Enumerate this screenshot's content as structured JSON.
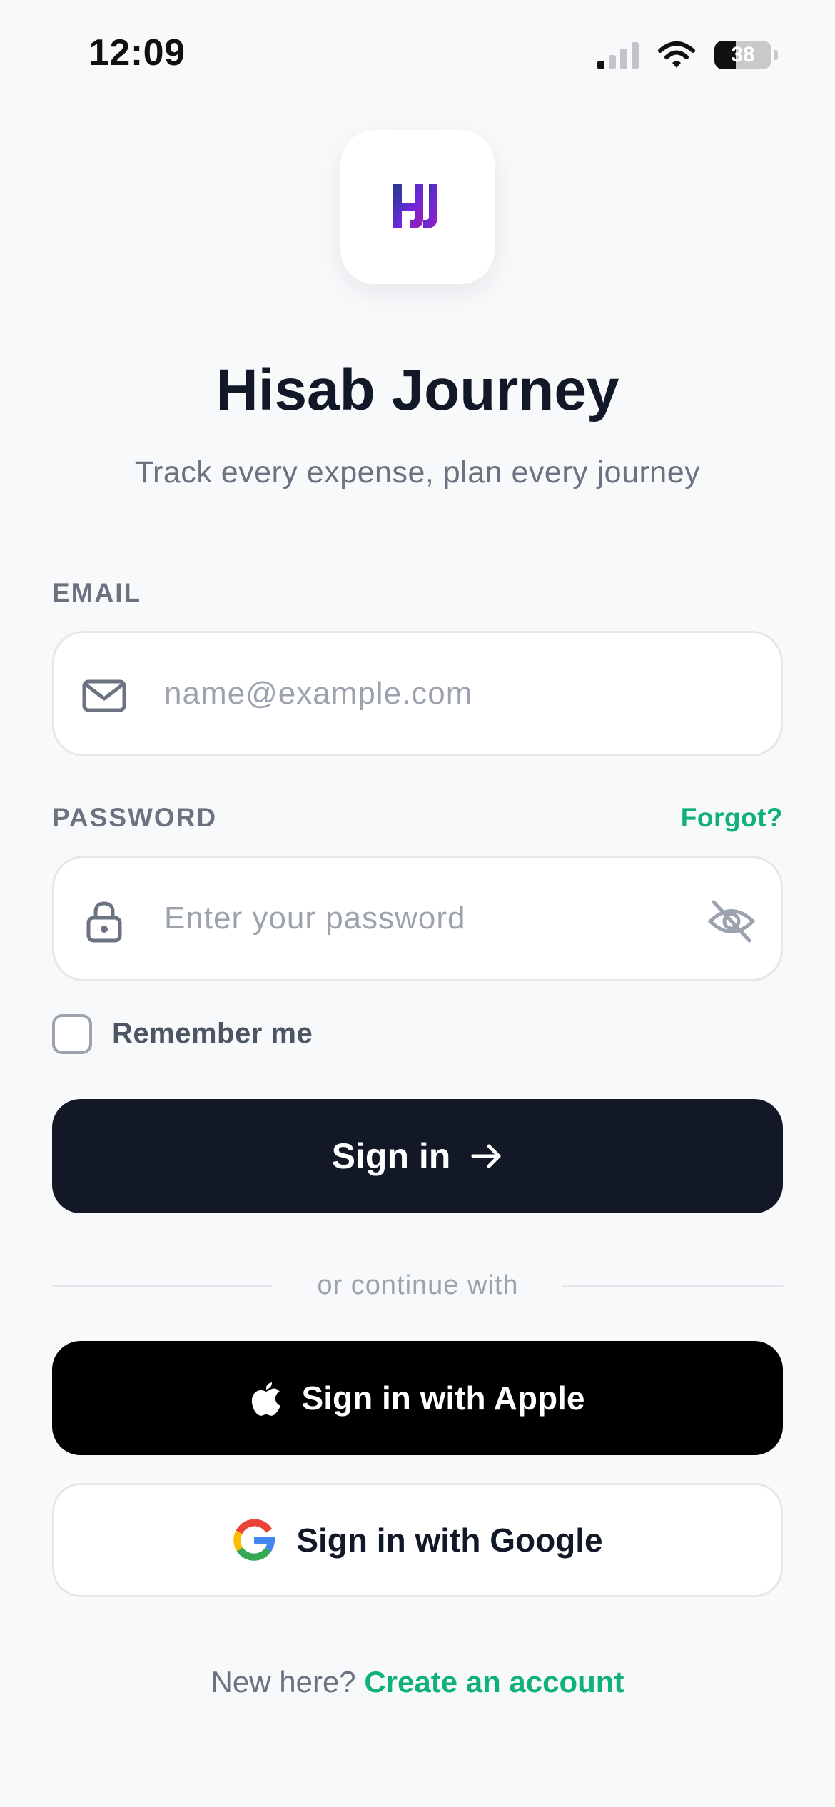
{
  "status_bar": {
    "time": "12:09",
    "battery_percent": "38",
    "battery_level": 0.38
  },
  "app": {
    "title": "Hisab Journey",
    "subtitle": "Track every expense, plan every journey",
    "logo_colors": [
      "#1e3a8a",
      "#6d28d9",
      "#a21caf"
    ]
  },
  "form": {
    "email_label": "EMAIL",
    "email_placeholder": "name@example.com",
    "email_value": "",
    "password_label": "PASSWORD",
    "password_placeholder": "Enter your password",
    "password_value": "",
    "forgot_label": "Forgot?",
    "remember_label": "Remember me",
    "remember_checked": false,
    "signin_label": "Sign in"
  },
  "divider": {
    "text": "or continue with"
  },
  "social": {
    "apple_label": "Sign in with Apple",
    "google_label": "Sign in with Google"
  },
  "footer": {
    "prompt": "New here?",
    "create_label": "Create an account"
  },
  "icons": {
    "email": "mail-icon",
    "password": "lock-icon",
    "visibility": "eye-off-icon",
    "signin": "arrow-right-icon",
    "apple": "apple-icon",
    "google": "google-icon"
  },
  "colors": {
    "accent": "#10b07a",
    "primary_button": "#121826",
    "apple_button": "#000000",
    "background": "#f8f9fb"
  }
}
